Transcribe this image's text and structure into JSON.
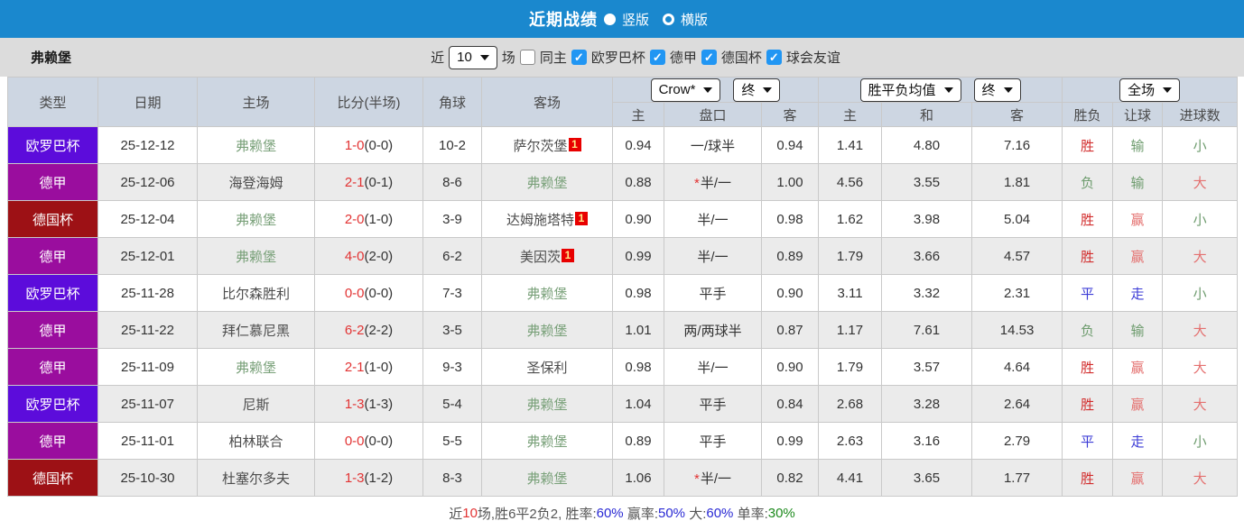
{
  "title_bar": {
    "title": "近期战绩",
    "radio_options": [
      {
        "label": "竖版",
        "selected": true
      },
      {
        "label": "横版",
        "selected": false
      }
    ]
  },
  "filter_bar": {
    "team": "弗赖堡",
    "recent_label": "近",
    "recent_value": "10",
    "matches_label": "场",
    "same_home_label": "同主",
    "same_home_checked": false,
    "competitions": [
      {
        "label": "欧罗巴杯",
        "checked": true
      },
      {
        "label": "德甲",
        "checked": true
      },
      {
        "label": "德国杯",
        "checked": true
      },
      {
        "label": "球会友谊",
        "checked": true
      }
    ]
  },
  "table": {
    "left_headers": [
      "类型",
      "日期",
      "主场",
      "比分(半场)",
      "角球",
      "客场"
    ],
    "group_dropdowns": {
      "odds_source": "Crow*",
      "odds_period": "终",
      "avg_source": "胜平负均值",
      "avg_period": "终",
      "scope": "全场"
    },
    "sub_headers": [
      "主",
      "盘口",
      "客",
      "主",
      "和",
      "客",
      "胜负",
      "让球",
      "进球数"
    ],
    "type_colors": {
      "欧罗巴杯": "#5c0cdb",
      "德甲": "#9a0d9e",
      "德国杯": "#9d1115"
    },
    "outcome_colors": {
      "胜": "#d22d2d",
      "负": "#6e9c6e",
      "平": "#3b3bd6",
      "赢": "#e4706f",
      "输": "#6e9c6e",
      "走": "#3b3bd6",
      "大": "#e4706f",
      "小": "#6e9c6e"
    },
    "rows": [
      {
        "type": "欧罗巴杯",
        "date": "25-12-12",
        "home": "弗赖堡",
        "home_fr": true,
        "score": "1-0",
        "half": "(0-0)",
        "corner": "10-2",
        "away": "萨尔茨堡",
        "away_fr": false,
        "away_badge": "1",
        "odds_home": "0.94",
        "handicap": "一/球半",
        "handicap_star": false,
        "odds_away": "0.94",
        "avg_home": "1.41",
        "avg_draw": "4.80",
        "avg_away": "7.16",
        "result": "胜",
        "handicap_result": "输",
        "goals": "小"
      },
      {
        "type": "德甲",
        "date": "25-12-06",
        "home": "海登海姆",
        "home_fr": false,
        "score": "2-1",
        "half": "(0-1)",
        "corner": "8-6",
        "away": "弗赖堡",
        "away_fr": true,
        "odds_home": "0.88",
        "handicap": "半/一",
        "handicap_star": true,
        "odds_away": "1.00",
        "avg_home": "4.56",
        "avg_draw": "3.55",
        "avg_away": "1.81",
        "result": "负",
        "handicap_result": "输",
        "goals": "大"
      },
      {
        "type": "德国杯",
        "date": "25-12-04",
        "home": "弗赖堡",
        "home_fr": true,
        "score": "2-0",
        "half": "(1-0)",
        "corner": "3-9",
        "away": "达姆施塔特",
        "away_fr": false,
        "away_badge": "1",
        "odds_home": "0.90",
        "handicap": "半/一",
        "handicap_star": false,
        "odds_away": "0.98",
        "avg_home": "1.62",
        "avg_draw": "3.98",
        "avg_away": "5.04",
        "result": "胜",
        "handicap_result": "赢",
        "goals": "小"
      },
      {
        "type": "德甲",
        "date": "25-12-01",
        "home": "弗赖堡",
        "home_fr": true,
        "score": "4-0",
        "half": "(2-0)",
        "corner": "6-2",
        "away": "美因茨",
        "away_fr": false,
        "away_badge": "1",
        "odds_home": "0.99",
        "handicap": "半/一",
        "handicap_star": false,
        "odds_away": "0.89",
        "avg_home": "1.79",
        "avg_draw": "3.66",
        "avg_away": "4.57",
        "result": "胜",
        "handicap_result": "赢",
        "goals": "大"
      },
      {
        "type": "欧罗巴杯",
        "date": "25-11-28",
        "home": "比尔森胜利",
        "home_fr": false,
        "score": "0-0",
        "half": "(0-0)",
        "corner": "7-3",
        "away": "弗赖堡",
        "away_fr": true,
        "odds_home": "0.98",
        "handicap": "平手",
        "handicap_star": false,
        "odds_away": "0.90",
        "avg_home": "3.11",
        "avg_draw": "3.32",
        "avg_away": "2.31",
        "result": "平",
        "handicap_result": "走",
        "goals": "小"
      },
      {
        "type": "德甲",
        "date": "25-11-22",
        "home": "拜仁慕尼黑",
        "home_fr": false,
        "score": "6-2",
        "half": "(2-2)",
        "corner": "3-5",
        "away": "弗赖堡",
        "away_fr": true,
        "odds_home": "1.01",
        "handicap": "两/两球半",
        "handicap_star": false,
        "odds_away": "0.87",
        "avg_home": "1.17",
        "avg_draw": "7.61",
        "avg_away": "14.53",
        "result": "负",
        "handicap_result": "输",
        "goals": "大"
      },
      {
        "type": "德甲",
        "date": "25-11-09",
        "home": "弗赖堡",
        "home_fr": true,
        "score": "2-1",
        "half": "(1-0)",
        "corner": "9-3",
        "away": "圣保利",
        "away_fr": false,
        "odds_home": "0.98",
        "handicap": "半/一",
        "handicap_star": false,
        "odds_away": "0.90",
        "avg_home": "1.79",
        "avg_draw": "3.57",
        "avg_away": "4.64",
        "result": "胜",
        "handicap_result": "赢",
        "goals": "大"
      },
      {
        "type": "欧罗巴杯",
        "date": "25-11-07",
        "home": "尼斯",
        "home_fr": false,
        "score": "1-3",
        "half": "(1-3)",
        "corner": "5-4",
        "away": "弗赖堡",
        "away_fr": true,
        "odds_home": "1.04",
        "handicap": "平手",
        "handicap_star": false,
        "odds_away": "0.84",
        "avg_home": "2.68",
        "avg_draw": "3.28",
        "avg_away": "2.64",
        "result": "胜",
        "handicap_result": "赢",
        "goals": "大"
      },
      {
        "type": "德甲",
        "date": "25-11-01",
        "home": "柏林联合",
        "home_fr": false,
        "score": "0-0",
        "half": "(0-0)",
        "corner": "5-5",
        "away": "弗赖堡",
        "away_fr": true,
        "odds_home": "0.89",
        "handicap": "平手",
        "handicap_star": false,
        "odds_away": "0.99",
        "avg_home": "2.63",
        "avg_draw": "3.16",
        "avg_away": "2.79",
        "result": "平",
        "handicap_result": "走",
        "goals": "小"
      },
      {
        "type": "德国杯",
        "date": "25-10-30",
        "home": "杜塞尔多夫",
        "home_fr": false,
        "score": "1-3",
        "half": "(1-2)",
        "corner": "8-3",
        "away": "弗赖堡",
        "away_fr": true,
        "odds_home": "1.06",
        "handicap": "半/一",
        "handicap_star": true,
        "odds_away": "0.82",
        "avg_home": "4.41",
        "avg_draw": "3.65",
        "avg_away": "1.77",
        "result": "胜",
        "handicap_result": "赢",
        "goals": "大"
      }
    ]
  },
  "summary": {
    "segments": [
      {
        "text": "近",
        "color": "#555555"
      },
      {
        "text": "10",
        "color": "#e23333"
      },
      {
        "text": "场,胜6平2负2, ",
        "color": "#555555"
      },
      {
        "text": "胜率:",
        "color": "#555555"
      },
      {
        "text": "60%",
        "color": "#2a2ad4"
      },
      {
        "text": " 赢率:",
        "color": "#555555"
      },
      {
        "text": "50%",
        "color": "#2a2ad4"
      },
      {
        "text": " 大:",
        "color": "#555555"
      },
      {
        "text": "60%",
        "color": "#2a2ad4"
      },
      {
        "text": " 单率:",
        "color": "#555555"
      },
      {
        "text": "30%",
        "color": "#1d8a1d"
      }
    ]
  }
}
